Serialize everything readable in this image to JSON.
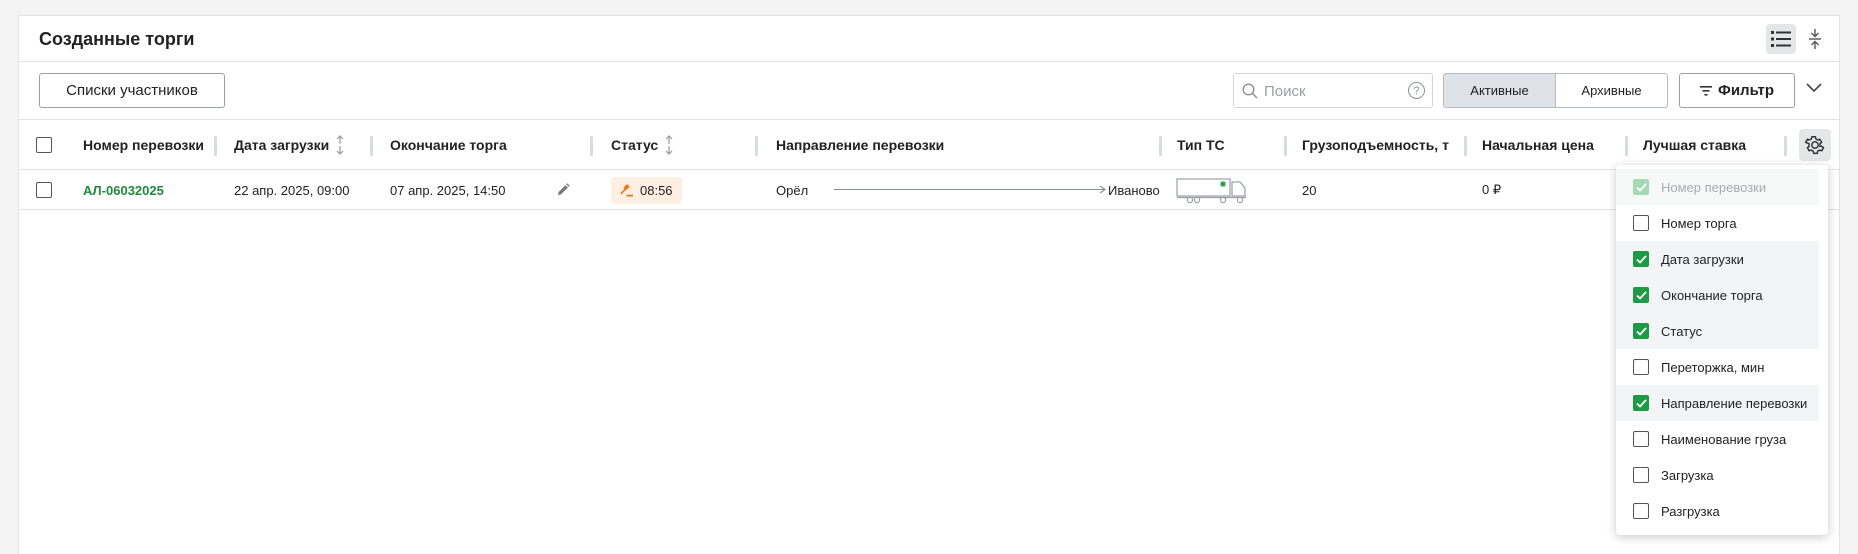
{
  "panel": {
    "title": "Созданные торги"
  },
  "toolbar": {
    "participants_label": "Списки участников",
    "search": {
      "placeholder": "Поиск",
      "value": "",
      "help": "?"
    },
    "tabs": [
      {
        "label": "Активные",
        "selected": true
      },
      {
        "label": "Архивные",
        "selected": false
      }
    ],
    "filter_label": "Фильтр"
  },
  "table": {
    "columns": [
      "Номер перевозки",
      "Дата загрузки",
      "Окончание торга",
      "Статус",
      "Направление перевозки",
      "Тип ТС",
      "Грузоподъемность, т",
      "Начальная цена",
      "Лучшая ставка"
    ],
    "rows": [
      {
        "number": "АЛ-06032025",
        "load_date": "22 апр. 2025, 09:00",
        "end_date": "07 апр. 2025, 14:50",
        "status": "08:56",
        "from": "Орёл",
        "to": "Иваново",
        "vehicle_icon": "refrigerator-truck-icon",
        "capacity": "20",
        "start_price": "0 ₽"
      }
    ]
  },
  "column_menu": {
    "items": [
      {
        "label": "Номер перевозки",
        "checked": true,
        "disabled": true
      },
      {
        "label": "Номер торга",
        "checked": false
      },
      {
        "label": "Дата загрузки",
        "checked": true
      },
      {
        "label": "Окончание торга",
        "checked": true
      },
      {
        "label": "Статус",
        "checked": true
      },
      {
        "label": "Переторжка, мин",
        "checked": false
      },
      {
        "label": "Направление перевозки",
        "checked": true
      },
      {
        "label": "Наименование груза",
        "checked": false
      },
      {
        "label": "Загрузка",
        "checked": false
      },
      {
        "label": "Разгрузка",
        "checked": false
      }
    ]
  },
  "colors": {
    "accent_green": "#1f9a44",
    "link_green": "#1f8a3d",
    "status_bg": "#fdf0e2",
    "status_icon": "#e87a1e"
  }
}
